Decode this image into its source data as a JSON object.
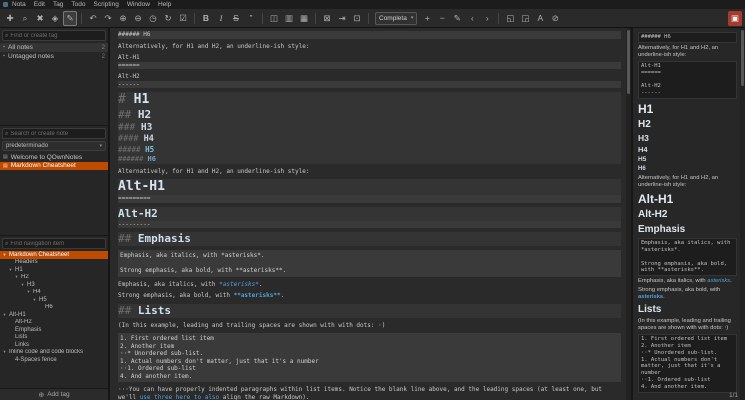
{
  "colors": {
    "accent_orange": "#bf4b00",
    "accent_blue": "#54a0dc",
    "heading_tint": "#d6e4f2",
    "log_icon_red": "#a63a2e"
  },
  "ui_icons": {
    "search": "⌕",
    "caret_down": "▾",
    "tree_arrow": "▾",
    "tag": "⬩",
    "note": "▤",
    "plus": "⊕"
  },
  "menubar": {
    "items": [
      "Nota",
      "Edit",
      "Tag",
      "Todo",
      "Scripting",
      "Window",
      "Help"
    ]
  },
  "toolbar": {
    "combo_label": "Completa",
    "items": [
      {
        "type": "btn",
        "name": "new-note-icon",
        "glyph": "✚"
      },
      {
        "type": "btn",
        "name": "find-note-icon",
        "glyph": "⌕"
      },
      {
        "type": "btn",
        "name": "remove-note-icon",
        "glyph": "✖"
      },
      {
        "type": "btn",
        "name": "tag-note-icon",
        "glyph": "◈"
      },
      {
        "type": "btn",
        "name": "edit-mode-icon",
        "glyph": "✎",
        "active": true
      },
      {
        "type": "sep"
      },
      {
        "type": "btn",
        "name": "undo-icon",
        "glyph": "↶"
      },
      {
        "type": "btn",
        "name": "redo-icon",
        "glyph": "↷"
      },
      {
        "type": "btn",
        "name": "zoom-in-icon",
        "glyph": "⊕"
      },
      {
        "type": "btn",
        "name": "zoom-out-icon",
        "glyph": "⊖"
      },
      {
        "type": "btn",
        "name": "recently-edited-icon",
        "glyph": "◷"
      },
      {
        "type": "btn",
        "name": "refresh-icon",
        "glyph": "↻"
      },
      {
        "type": "btn",
        "name": "todo-icon",
        "glyph": "☑"
      },
      {
        "type": "sep"
      },
      {
        "type": "btn",
        "name": "bold-icon",
        "glyph": "B"
      },
      {
        "type": "btn",
        "name": "italic-icon",
        "glyph": "I"
      },
      {
        "type": "btn",
        "name": "strikethrough-icon",
        "glyph": "S"
      },
      {
        "type": "btn",
        "name": "blockquote-icon",
        "glyph": "”"
      },
      {
        "type": "sep"
      },
      {
        "type": "btn",
        "name": "insert-link-icon",
        "glyph": "◫"
      },
      {
        "type": "btn",
        "name": "insert-image-icon",
        "glyph": "▥"
      },
      {
        "type": "btn",
        "name": "insert-table-icon",
        "glyph": "▦"
      },
      {
        "type": "sep"
      },
      {
        "type": "btn",
        "name": "lock-note-icon",
        "glyph": "⊠"
      },
      {
        "type": "btn",
        "name": "jump-to-note-icon",
        "glyph": "⇥"
      },
      {
        "type": "btn",
        "name": "unlock-note-icon",
        "glyph": "⊡"
      },
      {
        "type": "sep"
      },
      {
        "type": "combo",
        "name": "workspace-select"
      },
      {
        "type": "btn",
        "name": "font-increase-icon",
        "glyph": "+"
      },
      {
        "type": "btn",
        "name": "font-decrease-icon",
        "glyph": "−"
      },
      {
        "type": "btn",
        "name": "rename-note-icon",
        "glyph": "✎"
      },
      {
        "type": "btn",
        "name": "nav-back-icon",
        "glyph": "‹"
      },
      {
        "type": "btn",
        "name": "nav-forward-icon",
        "glyph": "›"
      },
      {
        "type": "sep"
      },
      {
        "type": "btn",
        "name": "maximize-editor-icon",
        "glyph": "◱"
      },
      {
        "type": "btn",
        "name": "fullscreen-icon",
        "glyph": "◲"
      },
      {
        "type": "btn",
        "name": "typography-icon",
        "glyph": "A"
      },
      {
        "type": "btn",
        "name": "clear-format-icon",
        "glyph": "⊘"
      },
      {
        "type": "spacer"
      },
      {
        "type": "btn",
        "name": "log-panel-icon",
        "glyph": "▣",
        "red": true
      }
    ]
  },
  "tag_panel": {
    "search_placeholder": "Find or create tag",
    "items": [
      {
        "label": "All notes",
        "count": "2",
        "selected": true
      },
      {
        "label": "Untagged notes",
        "count": "2",
        "selected": false
      }
    ],
    "add_tag_label": "Add tag"
  },
  "note_panel": {
    "search_placeholder": "Search or create note",
    "folder": "predeterminado",
    "notes": [
      {
        "title": "Welcome to QOwnNotes",
        "selected": false
      },
      {
        "title": "Markdown Cheatsheet",
        "selected": true
      }
    ]
  },
  "nav_panel": {
    "search_placeholder": "Find navigation item",
    "tree": [
      {
        "label": "Markdown Cheatsheet",
        "level": 0,
        "arrow": true,
        "selected": true
      },
      {
        "label": "Headers",
        "level": 1,
        "arrow": false
      },
      {
        "label": "H1",
        "level": 1,
        "arrow": true
      },
      {
        "label": "H2",
        "level": 2,
        "arrow": true
      },
      {
        "label": "H3",
        "level": 3,
        "arrow": true
      },
      {
        "label": "H4",
        "level": 4,
        "arrow": true
      },
      {
        "label": "H5",
        "level": 5,
        "arrow": true
      },
      {
        "label": "H6",
        "level": 6,
        "arrow": false
      },
      {
        "label": "Alt-H1",
        "level": 0,
        "arrow": true
      },
      {
        "label": "Alt-H2",
        "level": 1,
        "arrow": false
      },
      {
        "label": "Emphasis",
        "level": 1,
        "arrow": false
      },
      {
        "label": "Lists",
        "level": 1,
        "arrow": false
      },
      {
        "label": "Links",
        "level": 1,
        "arrow": false
      },
      {
        "label": "Inline code and code blocks",
        "level": 0,
        "arrow": true
      },
      {
        "label": "4-Spaces fence",
        "level": 1,
        "arrow": false
      }
    ]
  },
  "editor": {
    "blocks": [
      {
        "k": "hl",
        "text": "###### H6"
      },
      {
        "k": "gap"
      },
      {
        "k": "mono",
        "text": "Alternatively, for H1 and H2, an underline-ish style:"
      },
      {
        "k": "gap"
      },
      {
        "k": "mono",
        "text": "Alt-H1"
      },
      {
        "k": "hl",
        "text": "======"
      },
      {
        "k": "gap"
      },
      {
        "k": "mono",
        "text": "Alt-H2"
      },
      {
        "k": "hl",
        "text": "------"
      },
      {
        "k": "gap"
      },
      {
        "k": "h",
        "level": 1,
        "prefix": "# ",
        "text": "H1"
      },
      {
        "k": "h",
        "level": 2,
        "prefix": "## ",
        "text": "H2"
      },
      {
        "k": "h",
        "level": 3,
        "prefix": "### ",
        "text": "H3"
      },
      {
        "k": "h",
        "level": 4,
        "prefix": "#### ",
        "text": "H4"
      },
      {
        "k": "h",
        "level": 5,
        "prefix": "##### ",
        "text": "H5"
      },
      {
        "k": "h",
        "level": 6,
        "prefix": "###### ",
        "text": "H6"
      },
      {
        "k": "gap"
      },
      {
        "k": "mono",
        "text": "Alternatively, for H1 and H2, an underline-ish style:"
      },
      {
        "k": "gap"
      },
      {
        "k": "h",
        "level": 1,
        "prefix": "",
        "text": "Alt-H1"
      },
      {
        "k": "hl",
        "text": "========="
      },
      {
        "k": "gap"
      },
      {
        "k": "h",
        "level": 2,
        "prefix": "",
        "text": "Alt-H2"
      },
      {
        "k": "hl",
        "text": "---------"
      },
      {
        "k": "gap"
      },
      {
        "k": "h",
        "level": 2,
        "prefix": "## ",
        "text": "Emphasis"
      },
      {
        "k": "gap"
      },
      {
        "k": "code",
        "lines": [
          "Emphasis, aka italics, with *asterisks*.",
          "",
          "Strong emphasis, aka bold, with **asterisks**."
        ]
      },
      {
        "k": "gap"
      },
      {
        "k": "rich",
        "parts": [
          {
            "t": "Emphasis, aka italics, with "
          },
          {
            "t": "*asterisks*",
            "s": "italic-blue"
          },
          {
            "t": "."
          }
        ]
      },
      {
        "k": "gap"
      },
      {
        "k": "rich",
        "parts": [
          {
            "t": "Strong emphasis, aka bold, with "
          },
          {
            "t": "**asterisks**",
            "s": "bold-blue"
          },
          {
            "t": "."
          }
        ]
      },
      {
        "k": "gap"
      },
      {
        "k": "h",
        "level": 2,
        "prefix": "## ",
        "text": "Lists"
      },
      {
        "k": "gap"
      },
      {
        "k": "mono",
        "text": "(In this example, leading and trailing spaces are shown with with dots: ⋅)"
      },
      {
        "k": "gap"
      },
      {
        "k": "code",
        "lines": [
          "1. First ordered list item",
          "2. Another item",
          "⋅⋅* Unordered sub-list.",
          "1. Actual numbers don't matter, just that it's a number",
          "⋅⋅1. Ordered sub-list",
          "4. And another item."
        ]
      },
      {
        "k": "gap"
      },
      {
        "k": "rich",
        "parts": [
          {
            "t": "⋅⋅⋅You can have properly indented paragraphs within list items. Notice the blank line above, and the leading spaces (at least one, but we'll "
          },
          {
            "t": "use three here to also",
            "s": "blue"
          },
          {
            "t": " align the raw Markdown)."
          }
        ]
      }
    ]
  },
  "preview": {
    "blocks": [
      {
        "k": "code",
        "lines": [
          "###### H6"
        ]
      },
      {
        "k": "text",
        "text": "Alternatively, for H1 and H2, an underline-ish style:"
      },
      {
        "k": "code",
        "lines": [
          "Alt-H1",
          "======",
          "",
          "Alt-H2",
          "------"
        ]
      },
      {
        "k": "h1",
        "text": "H1"
      },
      {
        "k": "h2",
        "text": "H2"
      },
      {
        "k": "h3",
        "text": "H3"
      },
      {
        "k": "h4",
        "text": "H4"
      },
      {
        "k": "h5",
        "text": "H5"
      },
      {
        "k": "h6",
        "text": "H6"
      },
      {
        "k": "text",
        "text": "Alternatively, for H1 and H2, an underline-ish style:"
      },
      {
        "k": "h1",
        "text": "Alt-H1"
      },
      {
        "k": "h2",
        "text": "Alt-H2"
      },
      {
        "k": "h2",
        "text": "Emphasis"
      },
      {
        "k": "code",
        "lines": [
          "Emphasis, aka italics, with *asterisks*.",
          "",
          "Strong emphasis, aka bold, with **asterisks**."
        ]
      },
      {
        "k": "rich",
        "parts": [
          {
            "t": "Emphasis, aka italics, with "
          },
          {
            "t": "asterisks",
            "s": "italic-blue"
          },
          {
            "t": "."
          }
        ]
      },
      {
        "k": "rich",
        "parts": [
          {
            "t": "Strong emphasis, aka bold, with "
          },
          {
            "t": "asterisks",
            "s": "bold-blue"
          },
          {
            "t": "."
          }
        ]
      },
      {
        "k": "h2",
        "text": "Lists"
      },
      {
        "k": "text",
        "text": "(In this example, leading and trailing spaces are shown with with dots: ⋅)"
      },
      {
        "k": "code",
        "lines": [
          "1. First ordered list item",
          "2. Another item",
          "⋅⋅* Unordered sub-list.",
          "1. Actual numbers don't matter, just that it's a number",
          "⋅⋅1. Ordered sub-list",
          "4. And another item."
        ]
      }
    ]
  },
  "statusbar": {
    "page": "1/1"
  }
}
